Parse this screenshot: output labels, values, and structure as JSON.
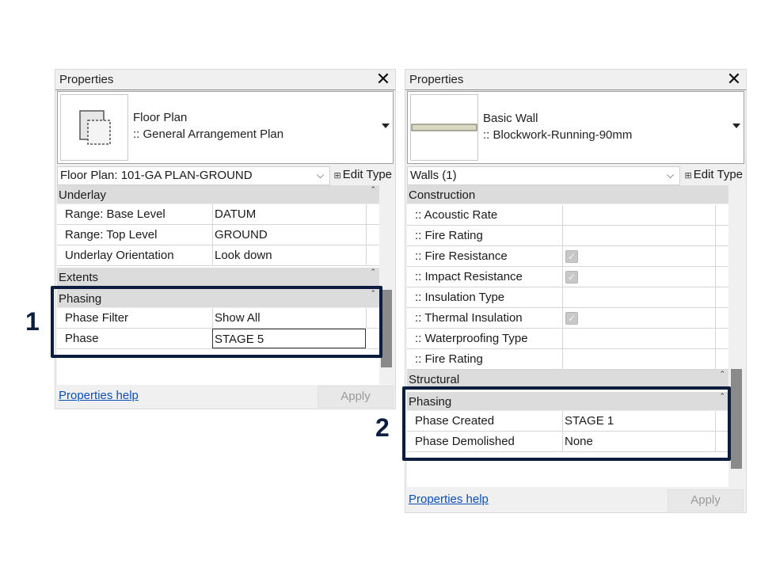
{
  "left_panel": {
    "title": "Properties",
    "close_symbol": "✕",
    "type_line1": "Floor Plan",
    "type_line2": ":: General Arrangement Plan",
    "thumbnail_icon": "floor-plan-icon",
    "selector": "Floor Plan: 101-GA PLAN-GROUND",
    "edit_type": "Edit Type",
    "groups": {
      "underlay": "Underlay",
      "extents": "Extents",
      "phasing": "Phasing"
    },
    "rows": {
      "base_level": {
        "name": "Range: Base Level",
        "value": "DATUM"
      },
      "top_level": {
        "name": "Range: Top Level",
        "value": "GROUND"
      },
      "orientation": {
        "name": "Underlay Orientation",
        "value": "Look down"
      },
      "phase_filter": {
        "name": "Phase Filter",
        "value": "Show All"
      },
      "phase": {
        "name": "Phase",
        "value": "STAGE 5"
      }
    },
    "help": "Properties help",
    "apply": "Apply",
    "callout": "1"
  },
  "right_panel": {
    "title": "Properties",
    "close_symbol": "✕",
    "type_line1": "Basic Wall",
    "type_line2": ":: Blockwork-Running-90mm",
    "thumbnail_icon": "wall-preview-icon",
    "selector": "Walls (1)",
    "edit_type": "Edit Type",
    "groups": {
      "construction": "Construction",
      "structural": "Structural",
      "phasing": "Phasing"
    },
    "rows": {
      "acoustic": {
        "name": ":: Acoustic Rate",
        "value": ""
      },
      "fire_rating": {
        "name": ":: Fire Rating",
        "value": ""
      },
      "fire_resistance": {
        "name": ":: Fire Resistance",
        "checked": true
      },
      "impact_resistance": {
        "name": ":: Impact Resistance",
        "checked": true
      },
      "insulation_type": {
        "name": ":: Insulation Type",
        "value": ""
      },
      "thermal": {
        "name": ":: Thermal Insulation",
        "checked": true
      },
      "waterproofing": {
        "name": ":: Waterproofing Type",
        "value": ""
      },
      "fire_rating2": {
        "name": ":: Fire Rating",
        "value": ""
      },
      "phase_created": {
        "name": "Phase Created",
        "value": "STAGE 1"
      },
      "phase_demolished": {
        "name": "Phase Demolished",
        "value": "None"
      }
    },
    "help": "Properties help",
    "apply": "Apply",
    "callout": "2"
  },
  "colors": {
    "highlight": "#0d1d3f",
    "link": "#0a50b4",
    "group_bg": "#dcdcdc"
  }
}
